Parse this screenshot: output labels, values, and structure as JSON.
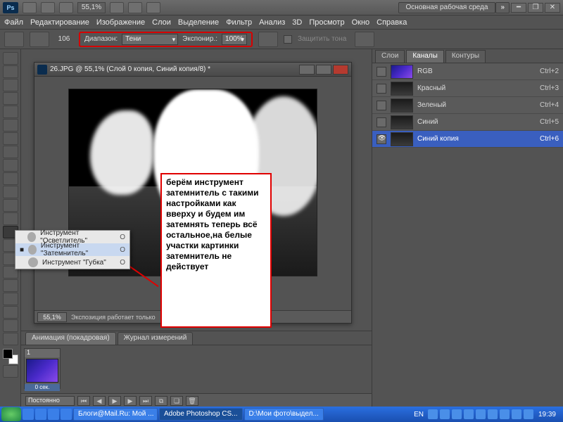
{
  "titlebar": {
    "zoom": "55,1%",
    "workspace_btn": "Основная рабочая среда"
  },
  "menus": [
    "Файл",
    "Редактирование",
    "Изображение",
    "Слои",
    "Выделение",
    "Фильтр",
    "Анализ",
    "3D",
    "Просмотр",
    "Окно",
    "Справка"
  ],
  "options": {
    "brush": "106",
    "range_label": "Диапазон:",
    "range_value": "Тени",
    "exposure_label": "Экспониp.:",
    "exposure_value": "100%",
    "protect_label": "Защитить тона"
  },
  "document": {
    "title": "26.JPG @ 55,1% (Слой 0 копия, Синий копия/8) *",
    "status_zoom": "55,1%",
    "status_text": "Экспозиция работает только"
  },
  "flyout": {
    "items": [
      {
        "label": "Инструмент \"Осветлитель\"",
        "key": "O",
        "sel": false
      },
      {
        "label": "Инструмент \"Затемнитель\"",
        "key": "O",
        "sel": true
      },
      {
        "label": "Инструмент \"Губка\"",
        "key": "O",
        "sel": false
      }
    ]
  },
  "annotation": "берём инструмент затемнитель с такими настройками как вверху и будем им затемнять теперь всё остальное,на белые участки картинки затемнитель не действует",
  "anim": {
    "tabs": [
      "Анимация (покадровая)",
      "Журнал измерений"
    ],
    "frame_num": "1",
    "frame_time": "0 сек.",
    "loop": "Постоянно"
  },
  "channels": {
    "tabs": [
      "Слои",
      "Каналы",
      "Контуры"
    ],
    "rows": [
      {
        "name": "RGB",
        "key": "Ctrl+2",
        "sel": false,
        "eye": false,
        "thumb": "rgb"
      },
      {
        "name": "Красный",
        "key": "Ctrl+3",
        "sel": false,
        "eye": false,
        "thumb": "r"
      },
      {
        "name": "Зеленый",
        "key": "Ctrl+4",
        "sel": false,
        "eye": false,
        "thumb": "r"
      },
      {
        "name": "Синий",
        "key": "Ctrl+5",
        "sel": false,
        "eye": false,
        "thumb": "r"
      },
      {
        "name": "Синий копия",
        "key": "Ctrl+6",
        "sel": true,
        "eye": true,
        "thumb": "r"
      }
    ]
  },
  "taskbar": {
    "items": [
      "Блоги@Mail.Ru: Мой ...",
      "Adobe Photoshop CS...",
      "D:\\Мои фото\\выдел..."
    ],
    "lang": "EN",
    "time": "19:39"
  }
}
